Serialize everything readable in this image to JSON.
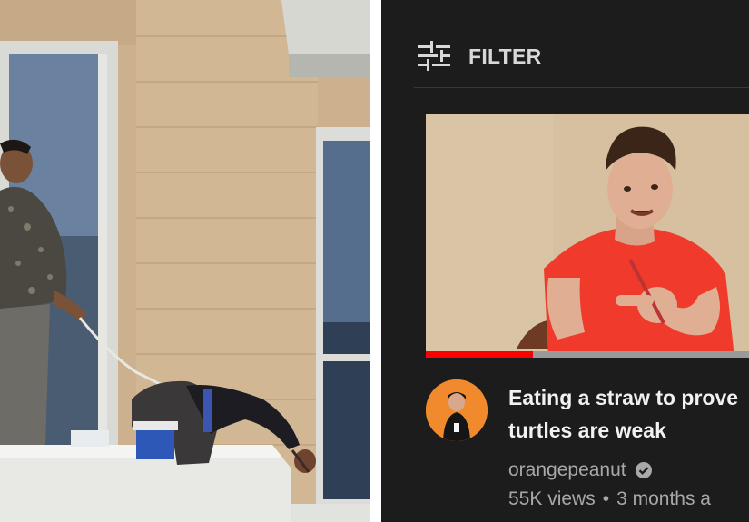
{
  "filter": {
    "label": "FILTER",
    "icon": "sliders-icon"
  },
  "video": {
    "title_line1": "Eating a straw to prove",
    "title_line2": "turtles are weak",
    "channel": "orangepeanut",
    "verified_icon": "verified-check-icon",
    "views": "55K views",
    "separator": "•",
    "age": "3 months a",
    "watched_progress": 0.32
  },
  "colors": {
    "background": "#1c1c1c",
    "progress_red": "#ff0000",
    "avatar_orange": "#f08a2c",
    "shirt_red": "#f03a2c"
  }
}
